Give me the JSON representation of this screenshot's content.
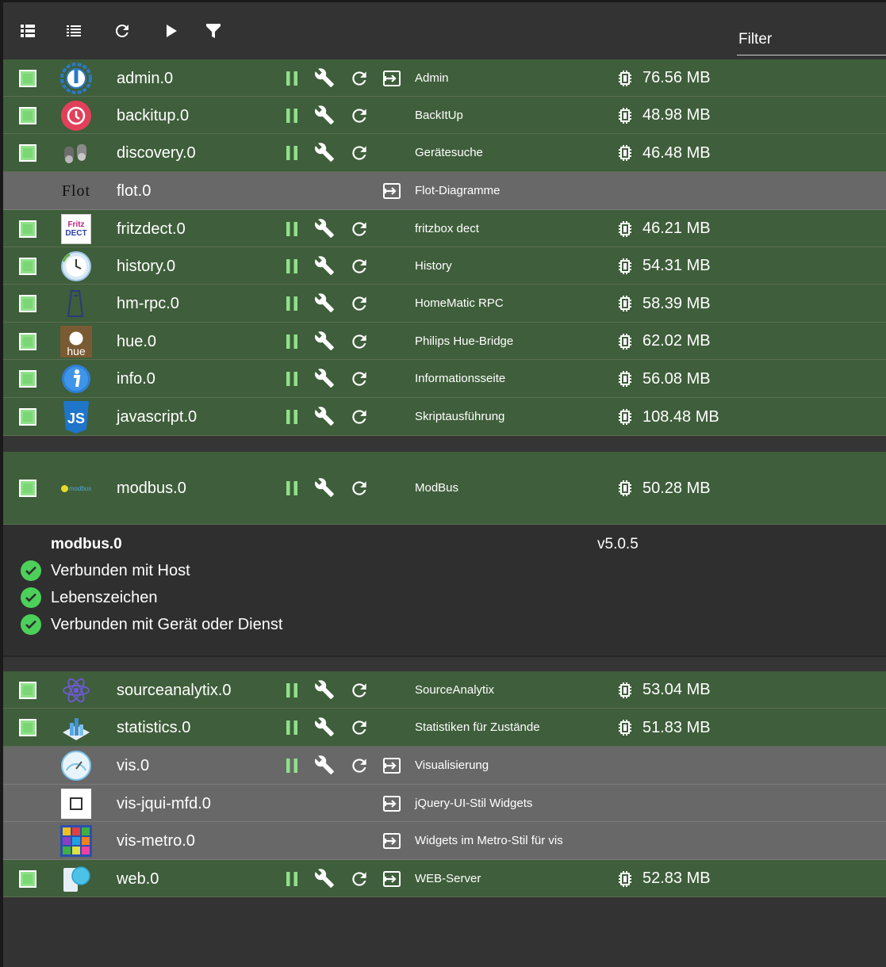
{
  "toolbar": {
    "icons": [
      "view-grid-icon",
      "view-list-icon",
      "refresh-icon",
      "play-icon",
      "filter-icon"
    ],
    "filter_placeholder": "Filter"
  },
  "colors": {
    "running_bg": "#3f5e3b",
    "stopped_bg": "#686868",
    "accent_green": "#8fe08a",
    "check_green": "#4cd05a"
  },
  "adapters": [
    {
      "name": "admin.0",
      "title": "Admin",
      "memory": "76.56 MB",
      "enabled": true,
      "icon": "admin-logo-icon"
    },
    {
      "name": "backitup.0",
      "title": "BackItUp",
      "memory": "48.98 MB",
      "enabled": true,
      "icon": "backitup-logo-icon"
    },
    {
      "name": "discovery.0",
      "title": "Gerätesuche",
      "memory": "46.48 MB",
      "enabled": true,
      "icon": "discovery-logo-icon"
    },
    {
      "name": "flot.0",
      "title": "Flot-Diagramme",
      "memory": "",
      "enabled": false,
      "icon": "flot-logo-icon",
      "logo_text": "Flot"
    },
    {
      "name": "fritzdect.0",
      "title": "fritzbox dect",
      "memory": "46.21 MB",
      "enabled": true,
      "icon": "fritzdect-logo-icon",
      "logo_text": "Fritz DECT"
    },
    {
      "name": "history.0",
      "title": "History",
      "memory": "54.31 MB",
      "enabled": true,
      "icon": "history-logo-icon"
    },
    {
      "name": "hm-rpc.0",
      "title": "HomeMatic RPC",
      "memory": "58.39 MB",
      "enabled": true,
      "icon": "hm-rpc-logo-icon"
    },
    {
      "name": "hue.0",
      "title": "Philips Hue-Bridge",
      "memory": "62.02 MB",
      "enabled": true,
      "icon": "hue-logo-icon",
      "logo_text": "hue"
    },
    {
      "name": "info.0",
      "title": "Informationsseite",
      "memory": "56.08 MB",
      "enabled": true,
      "icon": "info-logo-icon"
    },
    {
      "name": "javascript.0",
      "title": "Skriptausführung",
      "memory": "108.48 MB",
      "enabled": true,
      "icon": "javascript-logo-icon",
      "logo_text": "JS"
    },
    {
      "name": "modbus.0",
      "title": "ModBus",
      "memory": "50.28 MB",
      "enabled": true,
      "icon": "modbus-logo-icon",
      "logo_text": "modbus"
    },
    {
      "name": "sourceanalytix.0",
      "title": "SourceAnalytix",
      "memory": "53.04 MB",
      "enabled": true,
      "icon": "sourceanalytix-logo-icon"
    },
    {
      "name": "statistics.0",
      "title": "Statistiken für Zustände",
      "memory": "51.83 MB",
      "enabled": true,
      "icon": "statistics-logo-icon"
    },
    {
      "name": "vis.0",
      "title": "Visualisierung",
      "memory": "",
      "enabled": false,
      "icon": "vis-logo-icon"
    },
    {
      "name": "vis-jqui-mfd.0",
      "title": "jQuery-UI-Stil Widgets",
      "memory": "",
      "enabled": false,
      "icon": "vis-jqui-mfd-logo-icon"
    },
    {
      "name": "vis-metro.0",
      "title": "Widgets im Metro-Stil für vis",
      "memory": "",
      "enabled": false,
      "icon": "vis-metro-logo-icon"
    },
    {
      "name": "web.0",
      "title": "WEB-Server",
      "memory": "52.83 MB",
      "enabled": true,
      "icon": "web-logo-icon"
    }
  ],
  "details": {
    "name": "modbus.0",
    "version": "v5.0.5",
    "items": [
      "Verbunden mit Host",
      "Lebenszeichen",
      "Verbunden mit Gerät oder Dienst"
    ]
  }
}
